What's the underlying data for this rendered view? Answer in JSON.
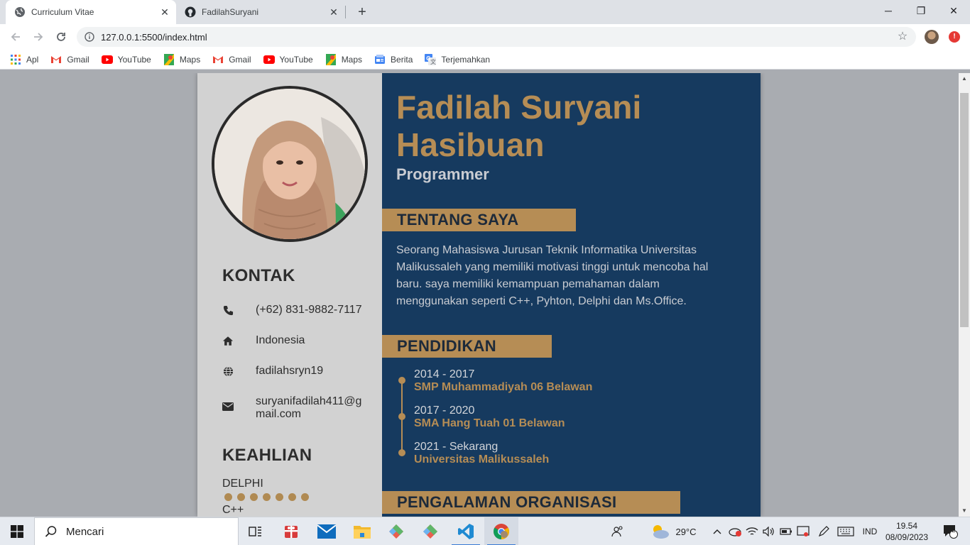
{
  "browser": {
    "tabs": [
      {
        "title": "Curriculum Vitae",
        "icon": "globe-icon",
        "active": true
      },
      {
        "title": "FadilahSuryani",
        "icon": "github-icon",
        "active": false
      }
    ],
    "url": "127.0.0.1:5500/index.html",
    "bookmarks": [
      {
        "label": "Apl",
        "icon": "apps-grid-icon"
      },
      {
        "label": "Gmail",
        "icon": "gmail-icon"
      },
      {
        "label": "YouTube",
        "icon": "youtube-icon"
      },
      {
        "label": "Maps",
        "icon": "maps-icon"
      },
      {
        "label": "Gmail",
        "icon": "gmail-icon"
      },
      {
        "label": "YouTube",
        "icon": "youtube-icon"
      },
      {
        "label": "Maps",
        "icon": "maps-icon"
      },
      {
        "label": "Berita",
        "icon": "news-icon"
      },
      {
        "label": "Terjemahkan",
        "icon": "translate-icon"
      }
    ],
    "update_badge": "!"
  },
  "cv": {
    "name_line1": "Fadilah Suryani",
    "name_line2": "Hasibuan",
    "role": "Programmer",
    "sections": {
      "contact": "KONTAK",
      "skills": "KEAHLIAN",
      "about": "TENTANG SAYA",
      "education": "PENDIDIKAN",
      "organization": "PENGALAMAN ORGANISASI"
    },
    "contacts": [
      {
        "icon": "phone-icon",
        "text": "(+62) 831-9882-7117"
      },
      {
        "icon": "home-icon",
        "text": "Indonesia"
      },
      {
        "icon": "globe-icon",
        "text": "fadilahsryn19"
      },
      {
        "icon": "envelope-icon",
        "text": "suryanifadilah411@gmail.com"
      }
    ],
    "skills": [
      {
        "name": "DELPHI",
        "level": 7
      },
      {
        "name": "C++"
      }
    ],
    "about": "Seorang Mahasiswa Jurusan Teknik Informatika Universitas Malikussaleh yang memiliki motivasi tinggi untuk mencoba hal baru. saya memiliki kemampuan pemahaman dalam menggunakan seperti C++, Pyhton, Delphi dan Ms.Office.",
    "education": [
      {
        "years": "2014 - 2017",
        "school": "SMP Muhammadiyah 06 Belawan"
      },
      {
        "years": "2017 - 2020",
        "school": "SMA Hang Tuah 01 Belawan"
      },
      {
        "years": "2021 - Sekarang",
        "school": "Universitas Malikussaleh"
      }
    ],
    "colors": {
      "navy": "#163a5f",
      "gold": "#b68d55",
      "grey": "#d2d2d2"
    }
  },
  "taskbar": {
    "search_placeholder": "Mencari",
    "weather": "29°C",
    "language": "IND",
    "time": "19.54",
    "date": "08/09/2023",
    "notifications": "2"
  }
}
